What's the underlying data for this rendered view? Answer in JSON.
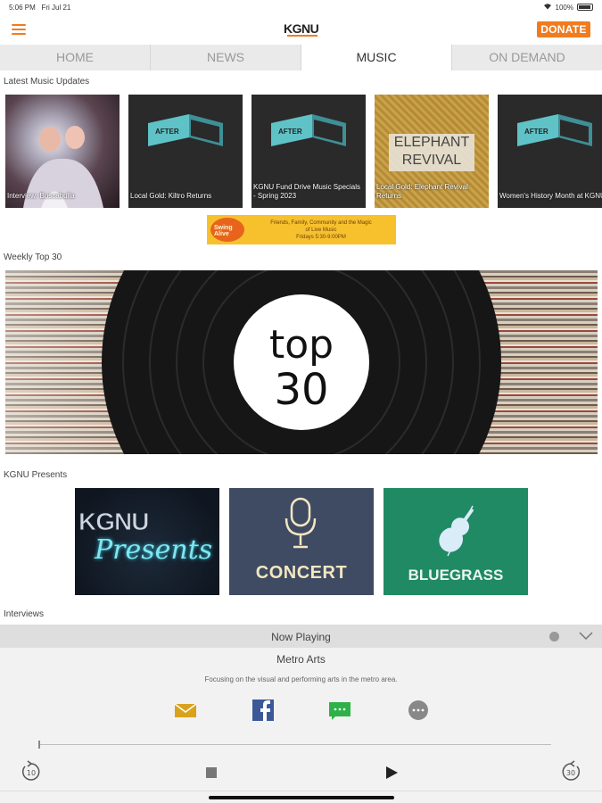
{
  "status_bar": {
    "time": "5:06 PM",
    "date": "Fri Jul 21",
    "battery": "100%",
    "icons": [
      "wifi-icon",
      "battery-icon"
    ]
  },
  "header": {
    "logo_text": "KGNU",
    "menu_icon": "hamburger-menu-icon",
    "donate_label": "DONATE",
    "accent_color": "#f07c1f"
  },
  "tabs": [
    {
      "label": "HOME",
      "active": false
    },
    {
      "label": "NEWS",
      "active": false
    },
    {
      "label": "MUSIC",
      "active": true
    },
    {
      "label": "ON DEMAND",
      "active": false
    }
  ],
  "sections": {
    "latest": "Latest Music Updates",
    "weekly": "Weekly Top 30",
    "presents": "KGNU Presents",
    "interviews": "Interviews"
  },
  "updates": [
    {
      "caption": "Interview: Buscabulla",
      "art": "photo"
    },
    {
      "caption": "Local Gold: Kiltro Returns",
      "art": "after-fm-logo"
    },
    {
      "caption": "KGNU Fund Drive Music Specials - Spring 2023",
      "art": "after-fm-logo"
    },
    {
      "caption": "Local Gold: Elephant Revival Returns",
      "art": "elephant-revival"
    },
    {
      "caption": "Women's History Month at KGNU",
      "art": "after-fm-logo"
    }
  ],
  "art_text": {
    "after": "AFTER",
    "elephant_1": "ELEPHANT",
    "elephant_2": "REVIVAL"
  },
  "banner": {
    "logo": "Swing Alive",
    "line1": "Friends, Family, Community and the Magic",
    "line2": "of Live Music",
    "line3": "Fridays 5:30-9:00PM"
  },
  "top30": {
    "line1": "top",
    "line2": "30"
  },
  "presents": [
    {
      "kgnu": "KGNU",
      "script": "Presents"
    },
    {
      "label": "CONCERT",
      "icon": "microphone-icon"
    },
    {
      "label": "BLUEGRASS",
      "icon": "violin-icon"
    }
  ],
  "player": {
    "now_playing_label": "Now Playing",
    "show_name": "Metro Arts",
    "show_description": "Focusing on the visual and performing arts in the metro area.",
    "share_icons": [
      "email-icon",
      "facebook-icon",
      "sms-icon",
      "more-icon"
    ],
    "skip_back": "10",
    "skip_forward": "30",
    "progress": 0.0,
    "share_colors": {
      "email": "#d9a21b",
      "facebook": "#3b5998",
      "sms": "#2fb14a",
      "more": "#888888"
    }
  }
}
